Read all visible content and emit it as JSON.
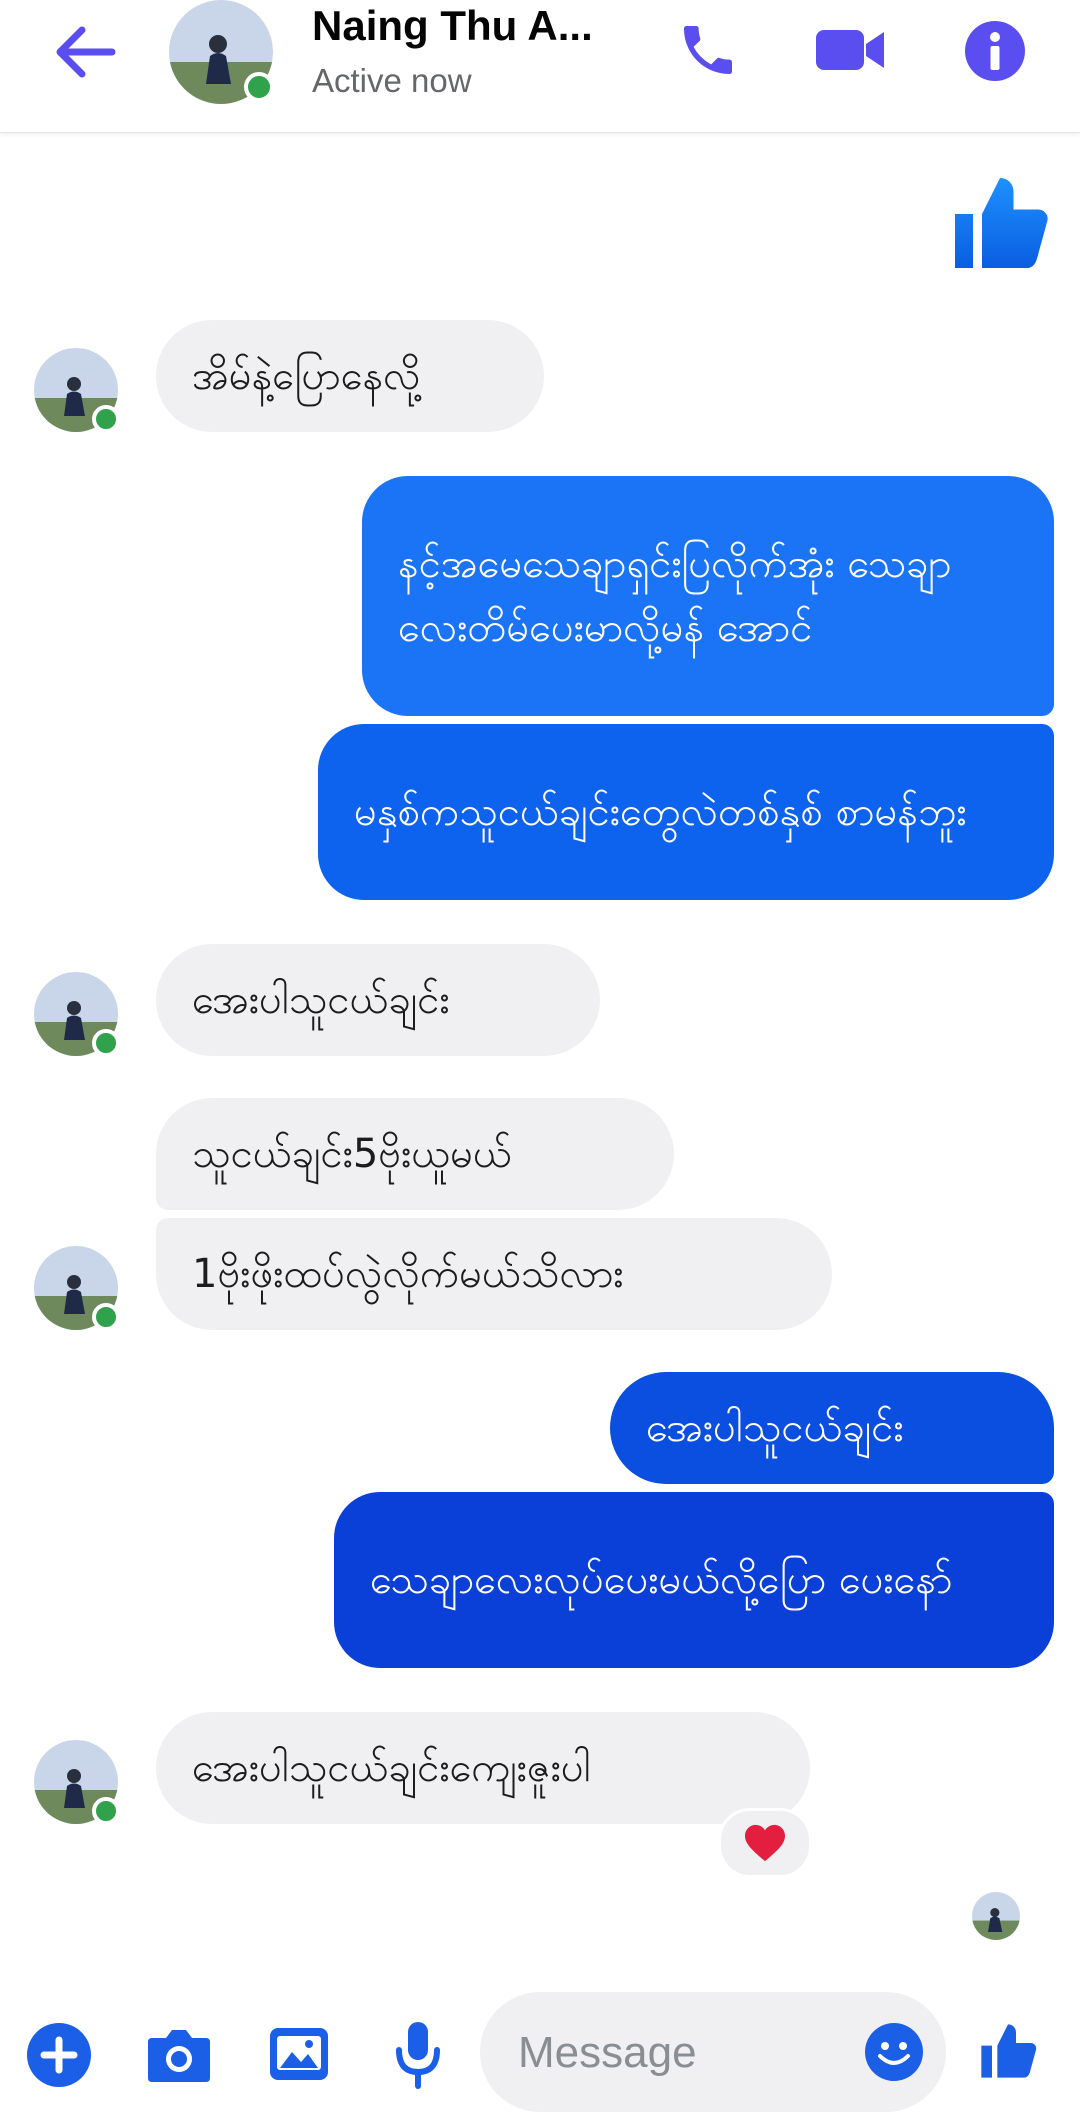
{
  "header": {
    "contact_name": "Naing Thu A...",
    "status": "Active now"
  },
  "colors": {
    "accent": "#5b4ef0",
    "messenger_blue": "#0a6cf0",
    "online": "#31a24c",
    "incoming_bubble": "#f0f0f3",
    "reaction_heart": "#e41e3f"
  },
  "messages": [
    {
      "direction": "outgoing",
      "type": "like-sticker"
    },
    {
      "direction": "incoming",
      "text": "အိမ်နဲ့ပြောနေလို့"
    },
    {
      "direction": "outgoing",
      "text": "နင့်အမေသေချာရှင်းပြလိုက်အုံး သေချာလေးတိမ်ပေးမာလို့မန် အောင်"
    },
    {
      "direction": "outgoing",
      "text": "မနှစ်ကသူငယ်ချင်းတွေလဲတစ်နှစ် စာမန်ဘူး"
    },
    {
      "direction": "incoming",
      "text": "အေးပါသူငယ်ချင်း"
    },
    {
      "direction": "incoming",
      "text": "သူငယ်ချင်း5ဗိုးယူမယ်"
    },
    {
      "direction": "incoming",
      "text": "1ဗိုးဖိုးထပ်လွဲလိုက်မယ်သိလား"
    },
    {
      "direction": "outgoing",
      "text": "အေးပါသူငယ်ချင်း"
    },
    {
      "direction": "outgoing",
      "text": "သေချာလေးလုပ်ပေးမယ်လို့ပြော ပေးနော်"
    },
    {
      "direction": "incoming",
      "text": "အေးပါသူငယ်ချင်းကျေးဇူးပါ",
      "reaction": "heart"
    }
  ],
  "composer": {
    "placeholder": "Message"
  }
}
